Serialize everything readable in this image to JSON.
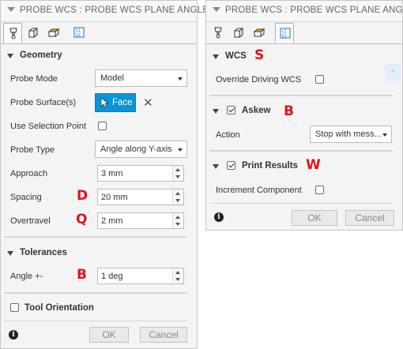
{
  "left_dialog": {
    "title": "PROBE WCS : PROBE WCS PLANE ANGLE",
    "tabs": [
      {
        "icon": "probe-tool-icon"
      },
      {
        "icon": "geometry-box-icon"
      },
      {
        "icon": "heights-box-icon"
      },
      {
        "icon": "post-process-icon"
      }
    ],
    "geometry": {
      "header": "Geometry",
      "probe_mode_label": "Probe Mode",
      "probe_mode_value": "Model",
      "probe_surface_label": "Probe Surface(s)",
      "face_button": "Face",
      "clear_symbol": "✕",
      "use_selection_point_label": "Use Selection Point",
      "probe_type_label": "Probe Type",
      "probe_type_value": "Angle along Y-axis",
      "approach_label": "Approach",
      "approach_value": "3 mm",
      "spacing_label": "Spacing",
      "spacing_value": "20 mm",
      "overtravel_label": "Overtravel",
      "overtravel_value": "2 mm"
    },
    "tolerances": {
      "header": "Tolerances",
      "angle_label": "Angle +-",
      "angle_value": "1 deg"
    },
    "tool_orientation": {
      "header": "Tool Orientation",
      "checked": false
    },
    "footer": {
      "info": "i",
      "ok": "OK",
      "cancel": "Cancel"
    }
  },
  "right_dialog": {
    "title": "PROBE WCS : PROBE WCS PLANE ANGLE",
    "tabs": [
      {
        "icon": "probe-tool-icon"
      },
      {
        "icon": "geometry-box-icon"
      },
      {
        "icon": "heights-box-icon"
      },
      {
        "icon": "post-process-icon"
      }
    ],
    "wcs": {
      "header": "WCS",
      "override_label": "Override Driving WCS"
    },
    "askew": {
      "header": "Askew",
      "checked": true,
      "action_label": "Action",
      "action_value": "Stop with mess..."
    },
    "print_results": {
      "header": "Print Results",
      "checked": true,
      "increment_label": "Increment Component"
    },
    "footer": {
      "info": "i",
      "ok": "OK",
      "cancel": "Cancel"
    }
  },
  "annotations": {
    "spacing": "D",
    "overtravel": "Q",
    "angle": "B",
    "wcs": "S",
    "askew": "B",
    "print_results": "W",
    "color": "#e0121a"
  },
  "colors": {
    "accent": "#0696d7"
  }
}
